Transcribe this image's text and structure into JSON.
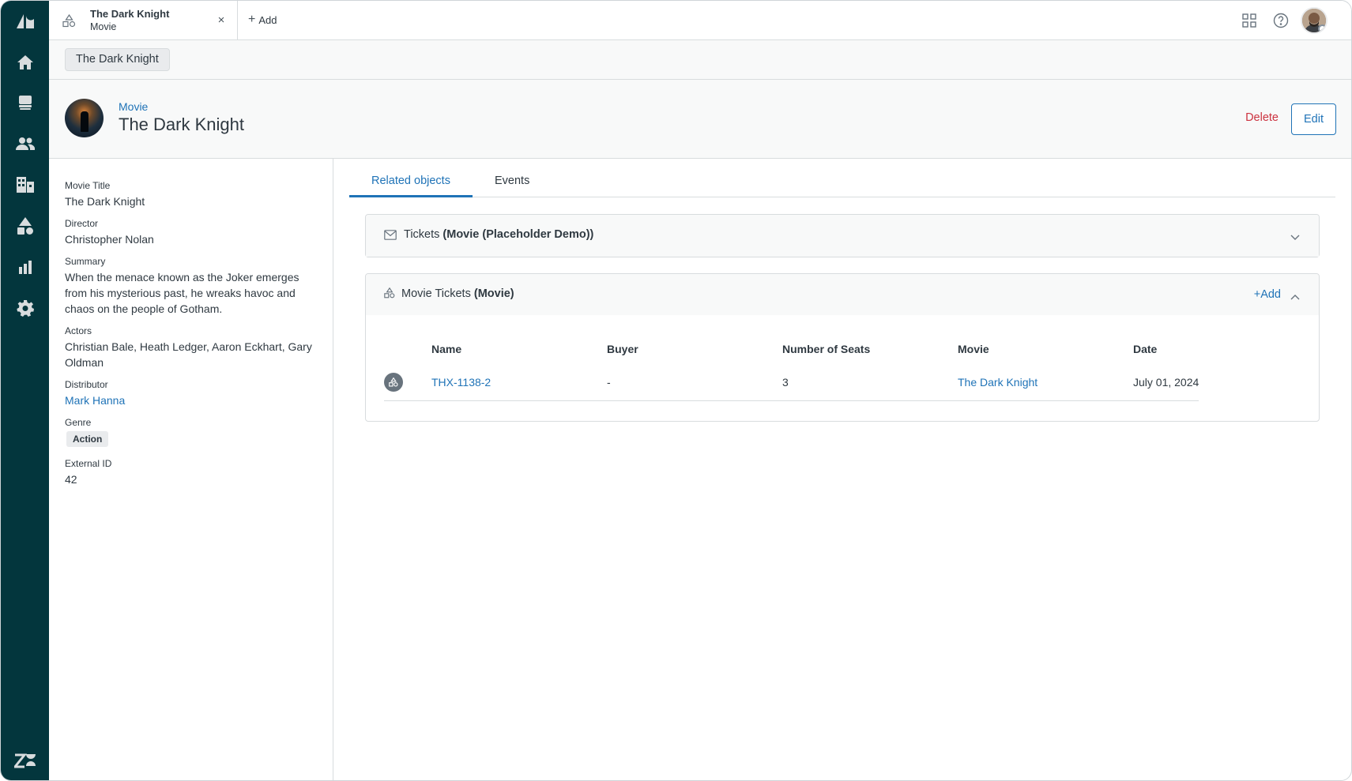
{
  "topbar": {
    "tab": {
      "title": "The Dark Knight",
      "subtitle": "Movie",
      "close": "×"
    },
    "add_label": "Add"
  },
  "breadcrumb": {
    "label": "The Dark Knight"
  },
  "header": {
    "type_label": "Movie",
    "title": "The Dark Knight",
    "delete_label": "Delete",
    "edit_label": "Edit"
  },
  "fields": {
    "movie_title": {
      "label": "Movie Title",
      "value": "The Dark Knight"
    },
    "director": {
      "label": "Director",
      "value": "Christopher Nolan"
    },
    "summary": {
      "label": "Summary",
      "value": "When the menace known as the Joker emerges from his mysterious past, he wreaks havoc and chaos on the people of Gotham."
    },
    "actors": {
      "label": "Actors",
      "value": "Christian Bale, Heath Ledger, Aaron Eckhart, Gary Oldman"
    },
    "distributor": {
      "label": "Distributor",
      "value": "Mark Hanna"
    },
    "genre": {
      "label": "Genre",
      "value": "Action"
    },
    "external_id": {
      "label": "External ID",
      "value": "42"
    }
  },
  "tabs": {
    "related": "Related objects",
    "events": "Events"
  },
  "sections": {
    "tickets": {
      "name": "Tickets",
      "qualifier": "(Movie (Placeholder Demo))"
    },
    "movie_tickets": {
      "name": "Movie Tickets",
      "qualifier": "(Movie)",
      "add_label": "Add",
      "columns": [
        "Name",
        "Buyer",
        "Number of Seats",
        "Movie",
        "Date"
      ],
      "rows": [
        {
          "name": "THX-1138-2",
          "buyer": "-",
          "seats": "3",
          "movie": "The Dark Knight",
          "date": "July 01, 2024"
        }
      ]
    }
  },
  "icons": {
    "nav": [
      "zendesk-logo-icon",
      "home-icon",
      "views-icon",
      "customers-icon",
      "organizations-icon",
      "objects-icon",
      "reporting-icon",
      "admin-icon",
      "zendesk-footer-icon"
    ]
  },
  "colors": {
    "nav_bg": "#03363d",
    "accent": "#1f73b7",
    "danger": "#cc3340"
  }
}
